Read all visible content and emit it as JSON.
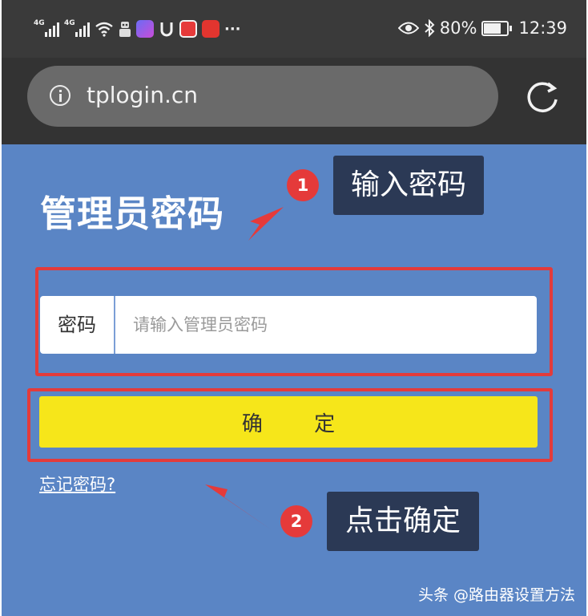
{
  "status_bar": {
    "signal_1_label": "4G",
    "signal_2_label": "4G",
    "more_indicator": "···",
    "battery_text": "80%",
    "battery_level": 0.8,
    "time": "12:39",
    "icons": [
      "signal-icon",
      "signal-icon",
      "wifi-icon",
      "robot-app-icon",
      "video-app-icon",
      "u-app-icon",
      "red-square-app-icon",
      "red-heart-app-icon",
      "eye-icon",
      "bluetooth-icon",
      "battery-icon"
    ]
  },
  "browser": {
    "url": "tplogin.cn",
    "info_icon": "info-icon",
    "refresh_icon": "refresh-icon"
  },
  "page": {
    "title": "管理员密码",
    "password_label": "密码",
    "password_placeholder": "请输入管理员密码",
    "password_value": "",
    "confirm_button": "确 定",
    "forgot_link": "忘记密码?"
  },
  "annotations": {
    "step1_number": "1",
    "step1_text": "输入密码",
    "step2_number": "2",
    "step2_text": "点击确定",
    "highlight_color": "#e33b3b",
    "callout_color": "#2b3955"
  },
  "watermark": "头条 @路由器设置方法",
  "colors": {
    "page_background": "#5a85c5",
    "button_yellow": "#f6e61a",
    "status_bar": "#3a3a3a"
  }
}
